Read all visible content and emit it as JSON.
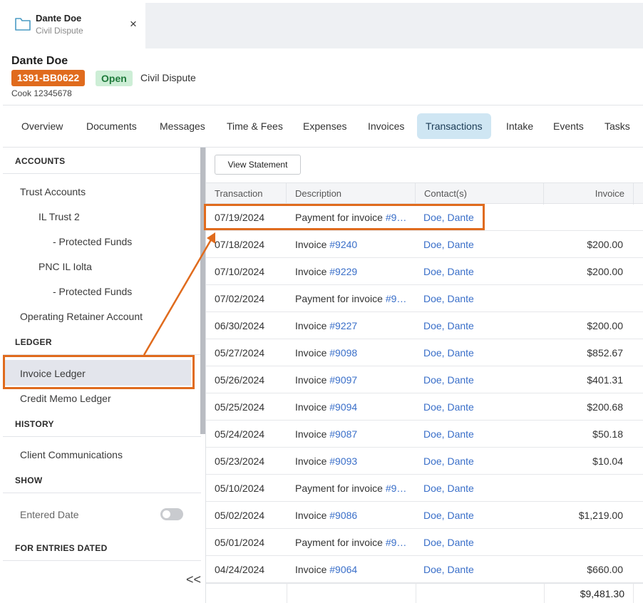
{
  "file_tab": {
    "name": "Dante Doe",
    "type": "Civil Dispute",
    "close": "×"
  },
  "matter": {
    "name": "Dante Doe",
    "number": "1391-BB0622",
    "status": "Open",
    "type": "Civil Dispute",
    "sub": "Cook 12345678"
  },
  "nav": {
    "tabs": [
      {
        "label": "Overview"
      },
      {
        "label": "Documents"
      },
      {
        "label": "Messages"
      },
      {
        "label": "Time & Fees"
      },
      {
        "label": "Expenses"
      },
      {
        "label": "Invoices"
      },
      {
        "label": "Transactions",
        "active": true
      },
      {
        "label": "Intake"
      },
      {
        "label": "Events"
      },
      {
        "label": "Tasks"
      }
    ]
  },
  "sidebar": {
    "accounts_header": "ACCOUNTS",
    "trust_accounts": "Trust Accounts",
    "il_trust": "IL Trust 2",
    "protected_funds_1": "- Protected Funds",
    "pnc": "PNC IL Iolta",
    "protected_funds_2": "- Protected Funds",
    "operating": "Operating Retainer Account",
    "ledger_header": "LEDGER",
    "invoice_ledger": "Invoice Ledger",
    "credit_memo": "Credit Memo Ledger",
    "history_header": "HISTORY",
    "client_comms": "Client Communications",
    "show_header": "SHOW",
    "entered_date": "Entered Date",
    "entries_header": "FOR ENTRIES DATED",
    "collapse": "<<"
  },
  "main": {
    "view_statement": "View Statement",
    "columns": {
      "transaction": "Transaction",
      "description": "Description",
      "contacts": "Contact(s)",
      "invoice": "Invoice"
    },
    "rows": [
      {
        "date": "07/19/2024",
        "desc": "Payment for invoice ",
        "link": "#9…",
        "contact": "Doe, Dante",
        "amount": ""
      },
      {
        "date": "07/18/2024",
        "desc": "Invoice ",
        "link": "#9240",
        "contact": "Doe, Dante",
        "amount": "$200.00"
      },
      {
        "date": "07/10/2024",
        "desc": "Invoice ",
        "link": "#9229",
        "contact": "Doe, Dante",
        "amount": "$200.00"
      },
      {
        "date": "07/02/2024",
        "desc": "Payment for invoice ",
        "link": "#9…",
        "contact": "Doe, Dante",
        "amount": ""
      },
      {
        "date": "06/30/2024",
        "desc": "Invoice ",
        "link": "#9227",
        "contact": "Doe, Dante",
        "amount": "$200.00"
      },
      {
        "date": "05/27/2024",
        "desc": "Invoice ",
        "link": "#9098",
        "contact": "Doe, Dante",
        "amount": "$852.67"
      },
      {
        "date": "05/26/2024",
        "desc": "Invoice ",
        "link": "#9097",
        "contact": "Doe, Dante",
        "amount": "$401.31"
      },
      {
        "date": "05/25/2024",
        "desc": "Invoice ",
        "link": "#9094",
        "contact": "Doe, Dante",
        "amount": "$200.68"
      },
      {
        "date": "05/24/2024",
        "desc": "Invoice ",
        "link": "#9087",
        "contact": "Doe, Dante",
        "amount": "$50.18"
      },
      {
        "date": "05/23/2024",
        "desc": "Invoice ",
        "link": "#9093",
        "contact": "Doe, Dante",
        "amount": "$10.04"
      },
      {
        "date": "05/10/2024",
        "desc": "Payment for invoice ",
        "link": "#9…",
        "contact": "Doe, Dante",
        "amount": ""
      },
      {
        "date": "05/02/2024",
        "desc": "Invoice ",
        "link": "#9086",
        "contact": "Doe, Dante",
        "amount": "$1,219.00"
      },
      {
        "date": "05/01/2024",
        "desc": "Payment for invoice ",
        "link": "#9…",
        "contact": "Doe, Dante",
        "amount": ""
      },
      {
        "date": "04/24/2024",
        "desc": "Invoice ",
        "link": "#9064",
        "contact": "Doe, Dante",
        "amount": "$660.00"
      }
    ],
    "total": "$9,481.30"
  },
  "colors": {
    "accent": "#e06b1d",
    "link": "#3a6fc9",
    "active_tab": "#cfe6f3",
    "open_badge": "#cdeed6"
  },
  "icons": {
    "file_tab": "folder-icon"
  }
}
